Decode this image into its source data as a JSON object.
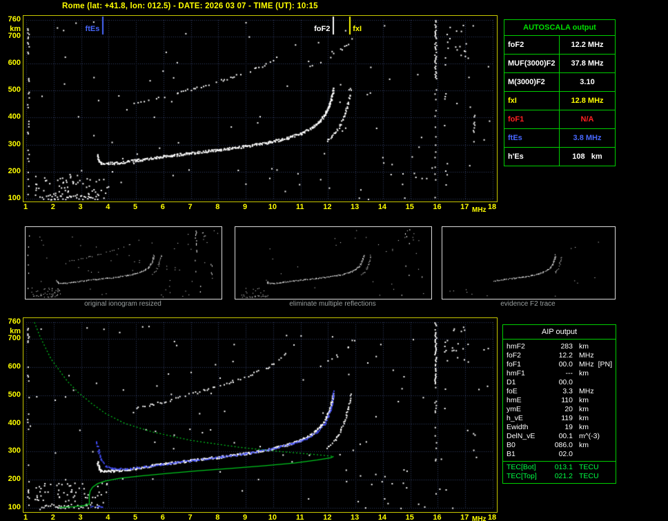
{
  "header": {
    "title": "Rome (lat: +41.8, lon: 012.5) - DATE: 2026 03 07 - TIME (UT): 10:15"
  },
  "autoscala_table": {
    "title": "AUTOSCALA output",
    "rows": [
      {
        "label": "foF2",
        "value": "12.2 MHz",
        "color": "#ffffff"
      },
      {
        "label": "MUF(3000)F2",
        "value": "37.8 MHz",
        "color": "#ffffff"
      },
      {
        "label": "M(3000)F2",
        "value": "3.10",
        "color": "#ffffff"
      },
      {
        "label": "fxI",
        "value": "12.8 MHz",
        "color": "#ffff00"
      },
      {
        "label": "foF1",
        "value": "N/A",
        "color": "#ff2222"
      },
      {
        "label": "ftEs",
        "value": "3.8 MHz",
        "color": "#4868ff"
      },
      {
        "label": "h'Es",
        "value": "108   km",
        "color": "#ffffff"
      }
    ]
  },
  "thumbnails": [
    {
      "caption": "original ionogram resized"
    },
    {
      "caption": "eliminate multiple reflections"
    },
    {
      "caption": "evidence F2 trace"
    }
  ],
  "aip_table": {
    "title": "AIP output",
    "text_color": "#ffffff",
    "tec_color": "#00ff44",
    "rows": [
      {
        "label": "hmF2",
        "value": "283",
        "unit": "km"
      },
      {
        "label": "foF2",
        "value": "12.2",
        "unit": "MHz"
      },
      {
        "label": "foF1",
        "value": "00.0",
        "unit": "MHz",
        "extra": "[PN]"
      },
      {
        "label": "hmF1",
        "value": "---",
        "unit": "km"
      },
      {
        "label": "D1",
        "value": "00.0",
        "unit": ""
      },
      {
        "label": "foE",
        "value": "3.3",
        "unit": "MHz"
      },
      {
        "label": "hmE",
        "value": "110",
        "unit": "km"
      },
      {
        "label": "ymE",
        "value": "20",
        "unit": "km"
      },
      {
        "label": "h_vE",
        "value": "119",
        "unit": "km"
      },
      {
        "label": "Ewidth",
        "value": "19",
        "unit": "km"
      },
      {
        "label": "DelN_vE",
        "value": "00.1",
        "unit": "m^(-3)"
      },
      {
        "label": "B0",
        "value": "086.0",
        "unit": "km"
      },
      {
        "label": "B1",
        "value": "02.0",
        "unit": ""
      }
    ],
    "tec_rows": [
      {
        "label": "TEC[Bot]",
        "value": "013.1",
        "unit": "TECU"
      },
      {
        "label": "TEC[Top]",
        "value": "021.2",
        "unit": "TECU"
      }
    ]
  },
  "chart_data": {
    "type": "scatter",
    "title": "ionogram (virtual height vs frequency)",
    "x_label": "MHz",
    "y_label": "km",
    "x_range": [
      1,
      18
    ],
    "y_range": [
      100,
      760
    ],
    "x_ticks": [
      1,
      2,
      3,
      4,
      5,
      6,
      7,
      8,
      9,
      10,
      11,
      12,
      13,
      14,
      15,
      16,
      17,
      18
    ],
    "y_ticks": [
      760,
      700,
      600,
      500,
      400,
      300,
      200,
      100
    ],
    "colors": {
      "grid": "#333f66",
      "frame": "#c8c800",
      "axis_text": "#ffff00",
      "dots": "#ffffff"
    },
    "markers": [
      {
        "name": "ftEs",
        "label": "ftEs",
        "freq": 3.8,
        "color": "#4868ff",
        "side": "left"
      },
      {
        "name": "foF2",
        "label": "foF2",
        "freq": 12.2,
        "color": "#ffffff",
        "side": "left"
      },
      {
        "name": "fxI",
        "label": "fxI",
        "freq": 12.8,
        "color": "#ffff00",
        "side": "right"
      }
    ],
    "traces": {
      "es": {
        "color": "#ffffff",
        "size": 2,
        "jitter": 3.2,
        "density": 0.8,
        "step": 2,
        "pts": [
          [
            1.45,
            103
          ],
          [
            2.0,
            105
          ],
          [
            2.6,
            107
          ],
          [
            3.15,
            108
          ],
          [
            3.62,
            107
          ]
        ]
      },
      "f2o": {
        "color": "#ffffff",
        "size": 2,
        "jitter": 1.7,
        "density": 0.93,
        "step": 2,
        "passes": 2,
        "pts": [
          [
            3.58,
            263
          ],
          [
            3.63,
            246
          ],
          [
            3.7,
            234
          ],
          [
            4.2,
            233
          ],
          [
            5.0,
            243
          ],
          [
            6.0,
            258
          ],
          [
            7.0,
            270
          ],
          [
            8.0,
            282
          ],
          [
            9.0,
            295
          ],
          [
            9.8,
            309
          ],
          [
            10.5,
            326
          ],
          [
            11.0,
            343
          ],
          [
            11.4,
            364
          ],
          [
            11.7,
            390
          ],
          [
            11.9,
            418
          ],
          [
            12.02,
            445
          ],
          [
            12.1,
            470
          ],
          [
            12.15,
            492
          ],
          [
            12.18,
            508
          ]
        ]
      },
      "f2x": {
        "color": "#ffffff",
        "size": 2,
        "jitter": 1.4,
        "density": 0.8,
        "step": 2,
        "pts": [
          [
            11.95,
            316
          ],
          [
            12.25,
            345
          ],
          [
            12.45,
            378
          ],
          [
            12.6,
            415
          ],
          [
            12.7,
            450
          ],
          [
            12.77,
            482
          ],
          [
            12.81,
            507
          ]
        ]
      },
      "hop2": {
        "color": "#ffffff",
        "size": 2,
        "jitter": 1.8,
        "density": 0.5,
        "step": 3,
        "pts": [
          [
            4.7,
            452
          ],
          [
            5.5,
            468
          ],
          [
            6.5,
            492
          ],
          [
            7.5,
            521
          ],
          [
            8.5,
            552
          ],
          [
            9.3,
            580
          ],
          [
            10.0,
            612
          ],
          [
            10.45,
            648
          ]
        ]
      },
      "hop2x": {
        "color": "#ffffff",
        "size": 2,
        "jitter": 2.2,
        "density": 0.3,
        "step": 3,
        "pts": [
          [
            11.1,
            580
          ],
          [
            11.8,
            612
          ],
          [
            12.3,
            642
          ],
          [
            12.7,
            676
          ],
          [
            12.92,
            705
          ]
        ]
      },
      "profile_top": {
        "color": "#00c81e",
        "line": true,
        "dash": [
          2,
          3
        ],
        "pts": [
          [
            1.3,
            760
          ],
          [
            1.5,
            710
          ],
          [
            1.7,
            670
          ],
          [
            1.9,
            630
          ],
          [
            2.2,
            590
          ],
          [
            2.5,
            550
          ],
          [
            2.9,
            510
          ],
          [
            3.4,
            470
          ],
          [
            3.9,
            435
          ],
          [
            4.6,
            400
          ],
          [
            5.6,
            370
          ],
          [
            7.0,
            340
          ],
          [
            8.8,
            315
          ],
          [
            10.3,
            300
          ],
          [
            11.5,
            290
          ],
          [
            12.2,
            283
          ]
        ]
      },
      "profile_bottom": {
        "color": "#00c81e",
        "line": true,
        "pts": [
          [
            12.2,
            283
          ],
          [
            12.1,
            278
          ],
          [
            11.6,
            270
          ],
          [
            10.8,
            260
          ],
          [
            9.7,
            250
          ],
          [
            8.5,
            241
          ],
          [
            7.3,
            232
          ],
          [
            6.2,
            223
          ],
          [
            5.2,
            214
          ],
          [
            4.4,
            205
          ],
          [
            3.9,
            196
          ],
          [
            3.6,
            186
          ],
          [
            3.42,
            174
          ],
          [
            3.33,
            160
          ],
          [
            3.3,
            145
          ],
          [
            3.3,
            128
          ],
          [
            3.3,
            114
          ],
          [
            3.1,
            108
          ],
          [
            2.7,
            104
          ],
          [
            2.2,
            101
          ]
        ]
      },
      "fitted": {
        "color": "#4450ff",
        "size": 2,
        "jitter": 1.1,
        "density": 0.85,
        "step": 2,
        "pts": [
          [
            3.55,
            338
          ],
          [
            3.62,
            305
          ],
          [
            3.72,
            272
          ],
          [
            3.88,
            250
          ],
          [
            4.15,
            241
          ],
          [
            4.7,
            241
          ],
          [
            5.3,
            248
          ],
          [
            6.2,
            260
          ],
          [
            7.2,
            272
          ],
          [
            8.2,
            284
          ],
          [
            9.2,
            298
          ],
          [
            10.0,
            313
          ],
          [
            10.7,
            330
          ],
          [
            11.2,
            349
          ],
          [
            11.6,
            373
          ],
          [
            11.85,
            400
          ],
          [
            12.0,
            428
          ],
          [
            12.1,
            458
          ],
          [
            12.16,
            487
          ],
          [
            12.19,
            515
          ]
        ]
      },
      "fitted_es": {
        "color": "#4450ff",
        "size": 2,
        "jitter": 1.0,
        "density": 0.7,
        "step": 2,
        "pts": [
          [
            3.3,
            107
          ],
          [
            3.75,
            107
          ]
        ]
      }
    },
    "noise": {
      "streaks": [
        {
          "freq": 15.9,
          "h_from": 760,
          "h_to": 540,
          "density": 0.75
        },
        {
          "freq": 15.9,
          "h_from": 540,
          "h_to": 100,
          "density": 0.15
        },
        {
          "freq": 16.25,
          "h_from": 760,
          "h_to": 100,
          "density": 0.08
        },
        {
          "freq": 17.3,
          "h_from": 420,
          "h_to": 290,
          "density": 0.3
        },
        {
          "freq": 1.06,
          "h_from": 740,
          "h_to": 110,
          "density": 0.18
        }
      ],
      "clouds": [
        {
          "f_from": 1.3,
          "f_to": 4.0,
          "h_from": 110,
          "h_to": 190,
          "count": 60
        },
        {
          "f_from": 1.0,
          "f_to": 17.9,
          "h_from": 100,
          "h_to": 755,
          "count": 90
        },
        {
          "f_from": 16.3,
          "f_to": 17.1,
          "h_from": 620,
          "h_to": 745,
          "count": 16
        },
        {
          "f_from": 12.8,
          "f_to": 15.6,
          "h_from": 100,
          "h_to": 260,
          "count": 14
        }
      ]
    }
  }
}
